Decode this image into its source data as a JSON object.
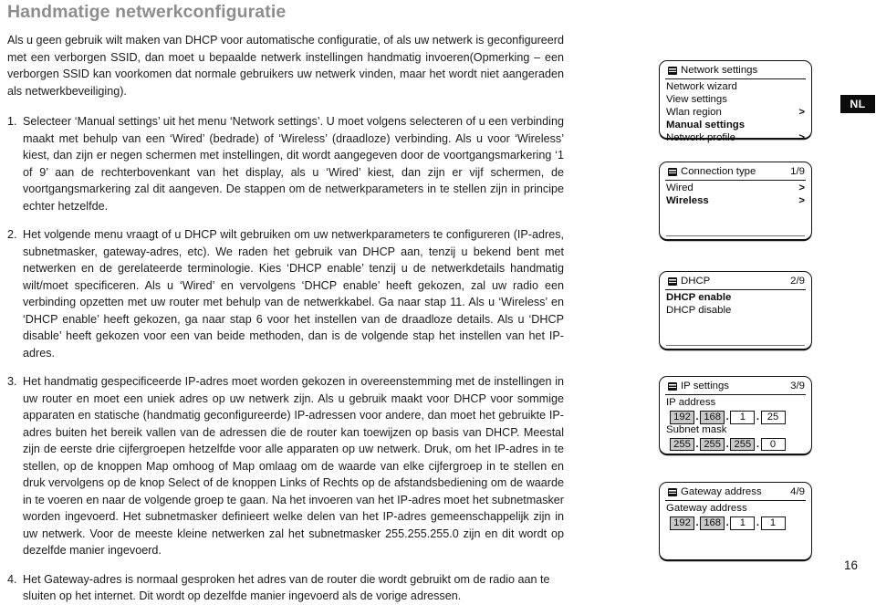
{
  "document": {
    "title": "Handmatige netwerkconfiguratie",
    "intro": "Als u geen gebruik wilt maken van DHCP voor automatische configuratie, of als uw netwerk is geconfigureerd met een verborgen SSID, dan moet u bepaalde netwerk instellingen handmatig invoeren(Opmerking – een verborgen SSID kan voorkomen dat normale gebruikers uw netwerk vinden, maar het wordt niet aangeraden als netwerkbeveiliging).",
    "steps": [
      {
        "number": "1.",
        "text": "Selecteer ‘Manual settings’ uit het menu ‘Network settings’. U moet volgens selecteren of u een verbinding maakt met behulp van een ‘Wired’ (bedrade) of ‘Wireless’ (draadloze) verbinding. Als u voor ‘Wireless’ kiest, dan zijn er negen schermen met instellingen, dit wordt aangegeven door de voortgangsmarkering ‘1 of 9’ aan de rechterbovenkant van het display, als u ‘Wired’ kiest, dan zijn er vijf schermen, de voortgangsmarkering zal dit aangeven. De stappen om de netwerkparameters in te stellen zijn in principe echter hetzelfde."
      },
      {
        "number": "2.",
        "text": "Het volgende menu vraagt of u DHCP wilt gebruiken om uw netwerkparameters te configureren (IP-adres, subnetmasker, gateway-adres, etc). We raden het gebruik van DHCP aan, tenzij u bekend bent met netwerken en de gerelateerde terminologie. Kies ‘DHCP enable’ tenzij u de netwerkdetails handmatig wilt/moet specificeren. Als u ‘Wired’ en vervolgens ‘DHCP enable’ heeft gekozen, zal uw radio een verbinding opzetten met uw router met behulp van de netwerkkabel. Ga naar stap 11. Als u ‘Wireless’ en ‘DHCP enable’ heeft gekozen, ga naar stap 6 voor het instellen van de draadloze details. Als u ‘DHCP disable’ heeft gekozen voor een van beide methoden, dan is de volgende stap het instellen van het IP-adres."
      },
      {
        "number": "3.",
        "text": "Het handmatig gespecificeerde IP-adres moet worden gekozen in overeenstemming met de instellingen in uw router en moet een uniek adres op uw netwerk zijn. Als u gebruik maakt voor DHCP voor sommige apparaten en statische (handmatig geconfigureerde) IP-adressen voor andere, dan moet het gebruikte IP-adres buiten het bereik vallen van de adressen die de router kan toewijzen op basis van DHCP. Meestal zijn de eerste drie cijfergroepen hetzelfde voor alle apparaten op uw netwerk. Druk, om het IP-adres in te stellen, op de knoppen Map omhoog of Map omlaag om de waarde van elke cijfergroep in te stellen en druk vervolgens op de knop Select of de knoppen Links of Rechts op de afstandsbediening om de waarde in te voeren en naar de volgende groep te gaan. Na het invoeren van het IP-adres moet het subnetmasker worden ingevoerd. Het subnetmasker definieert welke delen van het IP-adres gemeenschappelijk zijn in uw netwerk. Voor de meeste kleine netwerken zal het subnetmasker 255.255.255.0 zijn en dit wordt op dezelfde manier ingevoerd."
      },
      {
        "number": "4.",
        "text": "Het Gateway-adres is normaal gesproken het adres van de router die wordt gebruikt om de radio aan te sluiten op het internet. Dit wordt op dezelfde manier ingevoerd als de vorige adressen."
      }
    ],
    "page_number": "16",
    "language_badge": "NL"
  },
  "colors": {
    "title_gray": "#8d8d8d",
    "badge_background": "#0c0c0c",
    "badge_text": "#ffffff",
    "lcd_border": "#121212",
    "octet_shaded": "#c9c9c9"
  },
  "device_screens": [
    {
      "id": "network-settings",
      "icon": "menu-list-icon",
      "title": "Network settings",
      "counter": "",
      "rows": [
        {
          "label": "Network wizard",
          "arrow": "",
          "selected": false
        },
        {
          "label": "View settings",
          "arrow": "",
          "selected": false
        },
        {
          "label": "Wlan region",
          "arrow": ">",
          "selected": false
        },
        {
          "label": "Manual settings",
          "arrow": "",
          "selected": true
        },
        {
          "label": "Network profile",
          "arrow": ">",
          "selected": false
        }
      ]
    },
    {
      "id": "connection-type",
      "icon": "menu-list-icon",
      "title": "Connection type",
      "counter": "1/9",
      "rows": [
        {
          "label": "Wired",
          "arrow": ">",
          "selected": false
        },
        {
          "label": "Wireless",
          "arrow": ">",
          "selected": true
        }
      ]
    },
    {
      "id": "dhcp",
      "icon": "menu-list-icon",
      "title": "DHCP",
      "counter": "2/9",
      "rows": [
        {
          "label": "DHCP enable",
          "arrow": "",
          "selected": true
        },
        {
          "label": "DHCP disable",
          "arrow": "",
          "selected": false
        }
      ]
    },
    {
      "id": "ip-settings",
      "icon": "menu-list-icon",
      "title": "IP settings",
      "counter": "3/9",
      "fields": [
        {
          "label": "IP address",
          "octets": [
            {
              "value": "192",
              "shaded": true
            },
            {
              "value": "168",
              "shaded": true
            },
            {
              "value": "1",
              "shaded": false
            },
            {
              "value": "25",
              "shaded": false
            }
          ]
        },
        {
          "label": "Subnet mask",
          "octets": [
            {
              "value": "255",
              "shaded": true
            },
            {
              "value": "255",
              "shaded": true
            },
            {
              "value": "255",
              "shaded": true
            },
            {
              "value": "0",
              "shaded": false
            }
          ]
        }
      ]
    },
    {
      "id": "gateway-address",
      "icon": "menu-list-icon",
      "title": "Gateway address",
      "counter": "4/9",
      "fields": [
        {
          "label": "Gateway address",
          "octets": [
            {
              "value": "192",
              "shaded": true
            },
            {
              "value": "168",
              "shaded": true
            },
            {
              "value": "1",
              "shaded": false
            },
            {
              "value": "1",
              "shaded": false
            }
          ]
        }
      ]
    }
  ]
}
